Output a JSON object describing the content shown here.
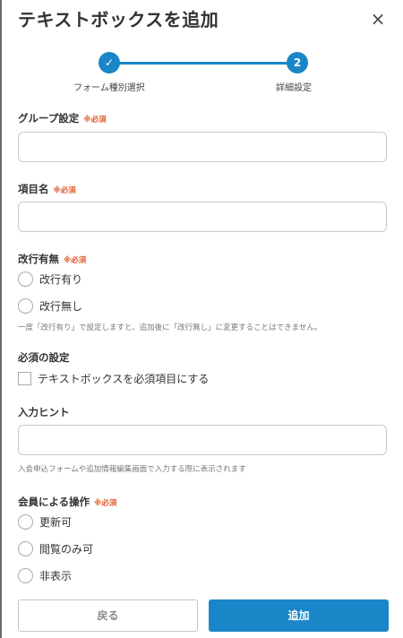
{
  "header": {
    "title": "テキストボックスを追加",
    "close_icon": "×"
  },
  "stepper": {
    "steps": [
      {
        "number": "✓",
        "label": "フォーム種別選択"
      },
      {
        "number": "2",
        "label": "詳細設定"
      }
    ],
    "accent_color": "#1a86c8"
  },
  "required_mark": "※必須",
  "fields": {
    "group": {
      "label": "グループ設定",
      "value": ""
    },
    "item_name": {
      "label": "項目名",
      "value": ""
    },
    "linebreak": {
      "label": "改行有無",
      "options": [
        "改行有り",
        "改行無し"
      ],
      "help": "一度「改行有り」で設定しますと、追加後に「改行無し」に変更することはできません。"
    },
    "required_setting": {
      "label": "必須の設定",
      "checkbox_label": "テキストボックスを必須項目にする"
    },
    "hint": {
      "label": "入力ヒント",
      "value": "",
      "help": "入会申込フォームや追加情報編集画面で入力する際に表示されます"
    },
    "member_operation": {
      "label": "会員による操作",
      "options": [
        "更新可",
        "閲覧のみ可",
        "非表示"
      ]
    }
  },
  "footer": {
    "back_label": "戻る",
    "add_label": "追加"
  }
}
